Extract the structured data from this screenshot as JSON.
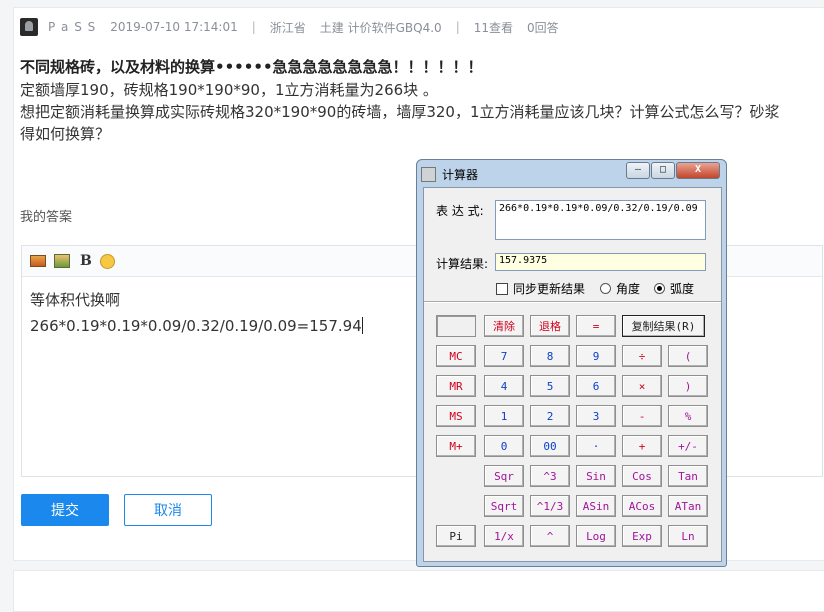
{
  "meta": {
    "user": "P a S S",
    "datetime": "2019-07-10 17:14:01",
    "sep": "|",
    "province": "浙江省",
    "tags": "土建 计价软件GBQ4.0",
    "views": "11查看",
    "answers": "0回答"
  },
  "question": {
    "title": "不同规格砖，以及材料的换算••••••急急急急急急急急！！！！！！",
    "line1": "定额墙厚190，砖规格190*190*90，1立方消耗量为266块 。",
    "line2": "想把定额消耗量换算成实际砖规格320*190*90的砖墙，墙厚320，1立方消耗量应该几块？计算公式怎么写？砂浆",
    "line3": "得如何换算？"
  },
  "answer": {
    "heading": "我的答案",
    "toolbar": {
      "bold": "B"
    },
    "line1": "等体积代换啊",
    "line2": "266*0.19*0.19*0.09/0.32/0.19/0.09=157.94"
  },
  "buttons": {
    "submit": "提交",
    "cancel": "取消"
  },
  "calculator": {
    "title": "计算器",
    "window_buttons": {
      "close": "X"
    },
    "expression_label": "表 达 式:",
    "expression": "266*0.19*0.19*0.09/0.32/0.19/0.09",
    "result_label": "计算结果:",
    "result": "157.9375",
    "sync_label": "同步更新结果",
    "degree_label": "角度",
    "radian_label": "弧度",
    "angle_mode": "radian",
    "keys": {
      "clear": "清除",
      "back": "退格",
      "equals": "=",
      "copy": "复制结果(R)",
      "mc": "MC",
      "mr": "MR",
      "ms": "MS",
      "mplus": "M+",
      "n7": "7",
      "n8": "8",
      "n9": "9",
      "div": "÷",
      "lparen": "(",
      "n4": "4",
      "n5": "5",
      "n6": "6",
      "mul": "×",
      "rparen": ")",
      "n1": "1",
      "n2": "2",
      "n3": "3",
      "minus": "-",
      "pct": "%",
      "n0": "0",
      "n00": "00",
      "dot": "·",
      "plus": "+",
      "neg": "+/-",
      "sqr": "Sqr",
      "cube": "^3",
      "sin": "Sin",
      "cos": "Cos",
      "tan": "Tan",
      "sqrt": "Sqrt",
      "cbrt": "^1/3",
      "asin": "ASin",
      "acos": "ACos",
      "atan": "ATan",
      "pi": "Pi",
      "inv": "1/x",
      "pow": "^",
      "log": "Log",
      "exp": "Exp",
      "ln": "Ln"
    }
  }
}
